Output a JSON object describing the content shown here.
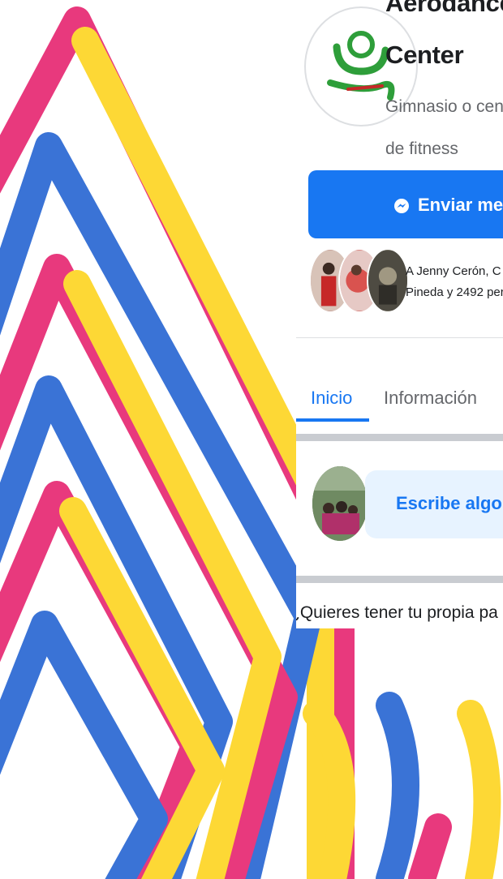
{
  "page": {
    "title_line1": "Aerodance",
    "title_line2": "Center",
    "category_line1": "Gimnasio o cen",
    "category_line2": "de fitness"
  },
  "actions": {
    "send_message_label": "Enviar mens"
  },
  "likes": {
    "line1": "A Jenny Cerón, C",
    "line2": "Pineda y 2492 per"
  },
  "tabs": [
    {
      "label": "Inicio",
      "active": true
    },
    {
      "label": "Información",
      "active": false
    }
  ],
  "composer": {
    "label": "Escribe algo"
  },
  "own_page_prompt": "¿Quieres tener tu propia pa",
  "colors": {
    "accent": "#1877f2",
    "pink": "#e8397d",
    "yellow": "#fdd835",
    "blue": "#3a73d6"
  },
  "icons": {
    "messenger": "messenger-icon",
    "logo": "aerodance-logo"
  }
}
